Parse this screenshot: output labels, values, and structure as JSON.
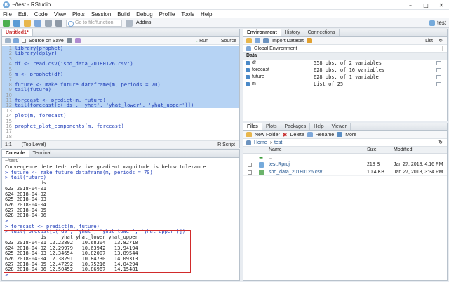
{
  "window": {
    "title": "~/test - RStudio",
    "project": "test"
  },
  "menu": [
    "File",
    "Edit",
    "Code",
    "View",
    "Plots",
    "Session",
    "Build",
    "Debug",
    "Profile",
    "Tools",
    "Help"
  ],
  "toolbar": {
    "goto_placeholder": "Go to file/function",
    "addins": "Addins"
  },
  "editor": {
    "tab": "Untitled1*",
    "source_on_save": "Source on Save",
    "run": "Run",
    "source": "Source",
    "status_pos": "1:1",
    "status_level": "(Top Level)",
    "status_type": "R Script",
    "lines": [
      {
        "n": "1",
        "text": "library(prophet)",
        "sel": true
      },
      {
        "n": "2",
        "text": "library(dplyr)",
        "sel": true
      },
      {
        "n": "3",
        "text": "",
        "sel": true
      },
      {
        "n": "4",
        "text": "df <- read.csv('sbd_data_20180126.csv')",
        "sel": true
      },
      {
        "n": "5",
        "text": "",
        "sel": true
      },
      {
        "n": "6",
        "text": "m <- prophet(df)",
        "sel": true
      },
      {
        "n": "7",
        "text": "",
        "sel": true
      },
      {
        "n": "8",
        "text": "future <- make_future_dataframe(m, periods = 70)",
        "sel": true
      },
      {
        "n": "9",
        "text": "tail(future)",
        "sel": true
      },
      {
        "n": "10",
        "text": "",
        "sel": true
      },
      {
        "n": "11",
        "text": "forecast <- predict(m, future)",
        "sel": true
      },
      {
        "n": "12",
        "text": "tail(forecast[c('ds', 'yhat', 'yhat_lower', 'yhat_upper')])",
        "sel": true
      },
      {
        "n": "13",
        "text": "",
        "sel": false
      },
      {
        "n": "14",
        "text": "plot(m, forecast)",
        "sel": false
      },
      {
        "n": "15",
        "text": "",
        "sel": false
      },
      {
        "n": "16",
        "text": "prophet_plot_components(m, forecast)",
        "sel": false
      },
      {
        "n": "17",
        "text": "",
        "sel": false
      },
      {
        "n": "18",
        "text": "",
        "sel": false
      }
    ]
  },
  "console": {
    "tab": "Console",
    "tab2": "Terminal",
    "path": "~/test/",
    "lines": [
      {
        "t": "Convergence detected: relative gradient magnitude is below tolerance",
        "c": "out"
      },
      {
        "t": "> future <- make_future_dataframe(m, periods = 70)",
        "c": "cmd"
      },
      {
        "t": "> tail(future)",
        "c": "cmd"
      },
      {
        "t": "            ds",
        "c": "out"
      },
      {
        "t": "623 2018-04-01",
        "c": "out"
      },
      {
        "t": "624 2018-04-02",
        "c": "out"
      },
      {
        "t": "625 2018-04-03",
        "c": "out"
      },
      {
        "t": "626 2018-04-04",
        "c": "out"
      },
      {
        "t": "627 2018-04-05",
        "c": "out"
      },
      {
        "t": "628 2018-04-06",
        "c": "out"
      },
      {
        "t": ">",
        "c": "cmd"
      },
      {
        "t": "> forecast <- predict(m, future)",
        "c": "cmd"
      },
      {
        "t": "> tail(forecast[c('ds', 'yhat', 'yhat_lower', 'yhat_upper')])",
        "c": "cmd"
      },
      {
        "t": "            ds     yhat yhat_lower yhat_upper",
        "c": "out"
      },
      {
        "t": "623 2018-04-01 12.22892   10.68304   13.82710",
        "c": "out"
      },
      {
        "t": "624 2018-04-02 12.29979   10.63942   13.94194",
        "c": "out"
      },
      {
        "t": "625 2018-04-03 12.34654   10.82007   13.89544",
        "c": "out"
      },
      {
        "t": "626 2018-04-04 12.38291   10.84730   14.09313",
        "c": "out"
      },
      {
        "t": "627 2018-04-05 12.47292   10.75216   14.04294",
        "c": "out"
      },
      {
        "t": "628 2018-04-06 12.50452   10.86967   14.15481",
        "c": "out"
      },
      {
        "t": ">",
        "c": "cmd"
      }
    ]
  },
  "environment": {
    "tabs": [
      "Environment",
      "History",
      "Connections"
    ],
    "import": "Import Dataset",
    "list": "List",
    "scope": "Global Environment",
    "section": "Data",
    "rows": [
      {
        "name": "df",
        "value": "558 obs. of 2 variables"
      },
      {
        "name": "forecast",
        "value": "628 obs. of 16 variables"
      },
      {
        "name": "future",
        "value": "628 obs. of 1 variable"
      },
      {
        "name": "m",
        "value": "List of 25"
      }
    ]
  },
  "files": {
    "tabs": [
      "Files",
      "Plots",
      "Packages",
      "Help",
      "Viewer"
    ],
    "new_folder": "New Folder",
    "delete": "Delete",
    "rename": "Rename",
    "more": "More",
    "crumb_home": "Home",
    "crumb_dir": "test",
    "headers": {
      "name": "Name",
      "size": "Size",
      "modified": "Modified"
    },
    "up": "..",
    "rows": [
      {
        "name": "test.Rproj",
        "size": "218 B",
        "modified": "Jan 27, 2018, 4:16 PM"
      },
      {
        "name": "sbd_data_20180126.csv",
        "size": "10.4 KB",
        "modified": "Jan 27, 2018, 3:34 PM"
      }
    ]
  }
}
